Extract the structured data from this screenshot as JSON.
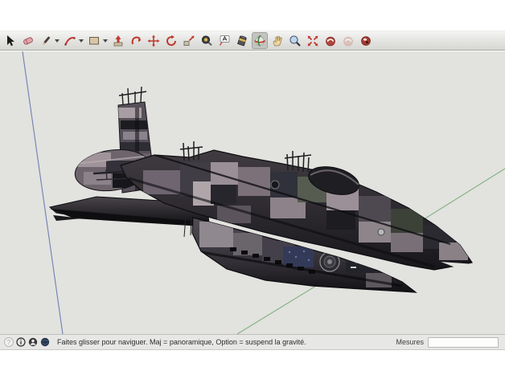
{
  "app": {
    "name": "SketchUp",
    "language": "fr",
    "accent_red": "#c03a30",
    "accent_green": "#3d8a3d"
  },
  "toolbar": {
    "tools": [
      {
        "name": "select",
        "active": false
      },
      {
        "name": "eraser",
        "active": false
      },
      {
        "name": "line",
        "active": false,
        "has_dropdown": true
      },
      {
        "name": "arc",
        "active": false,
        "has_dropdown": true
      },
      {
        "name": "rectangle",
        "active": false,
        "has_dropdown": true
      },
      {
        "name": "push-pull",
        "active": false
      },
      {
        "name": "follow-me",
        "active": false
      },
      {
        "name": "move",
        "active": false
      },
      {
        "name": "rotate",
        "active": false
      },
      {
        "name": "scale",
        "active": false
      },
      {
        "name": "tape-measure",
        "active": false
      },
      {
        "name": "text",
        "active": false
      },
      {
        "name": "paint-bucket",
        "active": false
      },
      {
        "name": "orbit",
        "active": true
      },
      {
        "name": "pan",
        "active": false
      },
      {
        "name": "zoom",
        "active": false
      },
      {
        "name": "zoom-extents",
        "active": false
      },
      {
        "name": "previous-view",
        "active": false
      },
      {
        "name": "next-view",
        "active": false,
        "disabled": true
      },
      {
        "name": "look-around",
        "active": false
      }
    ]
  },
  "viewport": {
    "background": "#e2e2df",
    "axes": {
      "blue_axis_color": "#6f7fb2",
      "green_axis_color": "#7fb27f"
    },
    "model": {
      "description": "Dark camouflage-textured capital spaceship 3D model"
    }
  },
  "statusbar": {
    "icons": [
      "help-circle",
      "info-circle",
      "person-circle",
      "globe-circle"
    ],
    "message": "Faites glisser pour naviguer. Maj = panoramique, Option =  suspend la gravité.",
    "help_glyph": "?",
    "measurements_label": "Mesures",
    "measurements_value": ""
  }
}
